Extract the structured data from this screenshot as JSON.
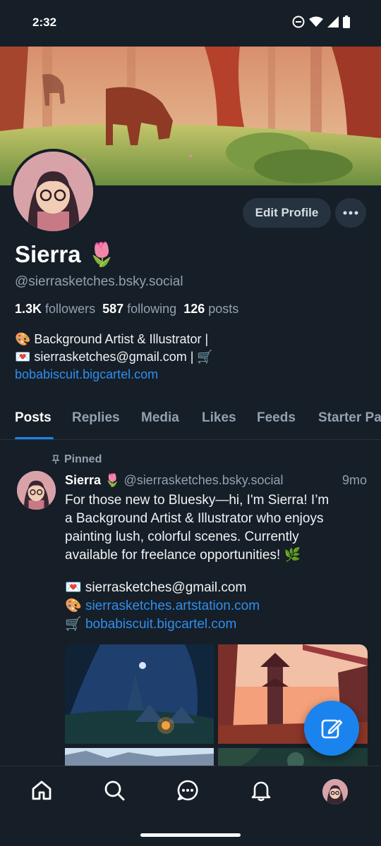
{
  "status": {
    "time": "2:32"
  },
  "profile": {
    "display_name": "Sierra 🌷",
    "handle": "@sierrasketches.bsky.social",
    "followers_count": "1.3K",
    "followers_label": "followers",
    "following_count": "587",
    "following_label": "following",
    "posts_count": "126",
    "posts_label": "posts",
    "bio_line1": "🎨 Background Artist & Illustrator |",
    "bio_line2": "💌 sierrasketches@gmail.com | 🛒",
    "bio_link": "bobabiscuit.bigcartel.com",
    "edit_label": "Edit Profile"
  },
  "tabs": [
    "Posts",
    "Replies",
    "Media",
    "Likes",
    "Feeds",
    "Starter Pa"
  ],
  "post": {
    "pinned_label": "Pinned",
    "author": "Sierra 🌷",
    "handle": "@sierrasketches.bsky.social",
    "time": "9mo",
    "line1": "For those new to Bluesky—hi, I'm Sierra! I’m",
    "line2": "a Background Artist & Illustrator who enjoys",
    "line3": "painting lush, colorful scenes. Currently",
    "line4": "available for freelance opportunities! 🌿",
    "email": "💌 sierrasketches@gmail.com",
    "artstation_prefix": "🎨 ",
    "artstation": "sierrasketches.artstation.com",
    "shop_prefix": "🛒 ",
    "shop": "bobabiscuit.bigcartel.com"
  },
  "colors": {
    "accent": "#1a83ee",
    "link": "#2f8fee",
    "background": "#161e27",
    "muted": "#93a1b1"
  },
  "icons": [
    "home-icon",
    "search-icon",
    "chat-icon",
    "bell-icon",
    "compose-icon",
    "more-icon",
    "pin-icon"
  ]
}
